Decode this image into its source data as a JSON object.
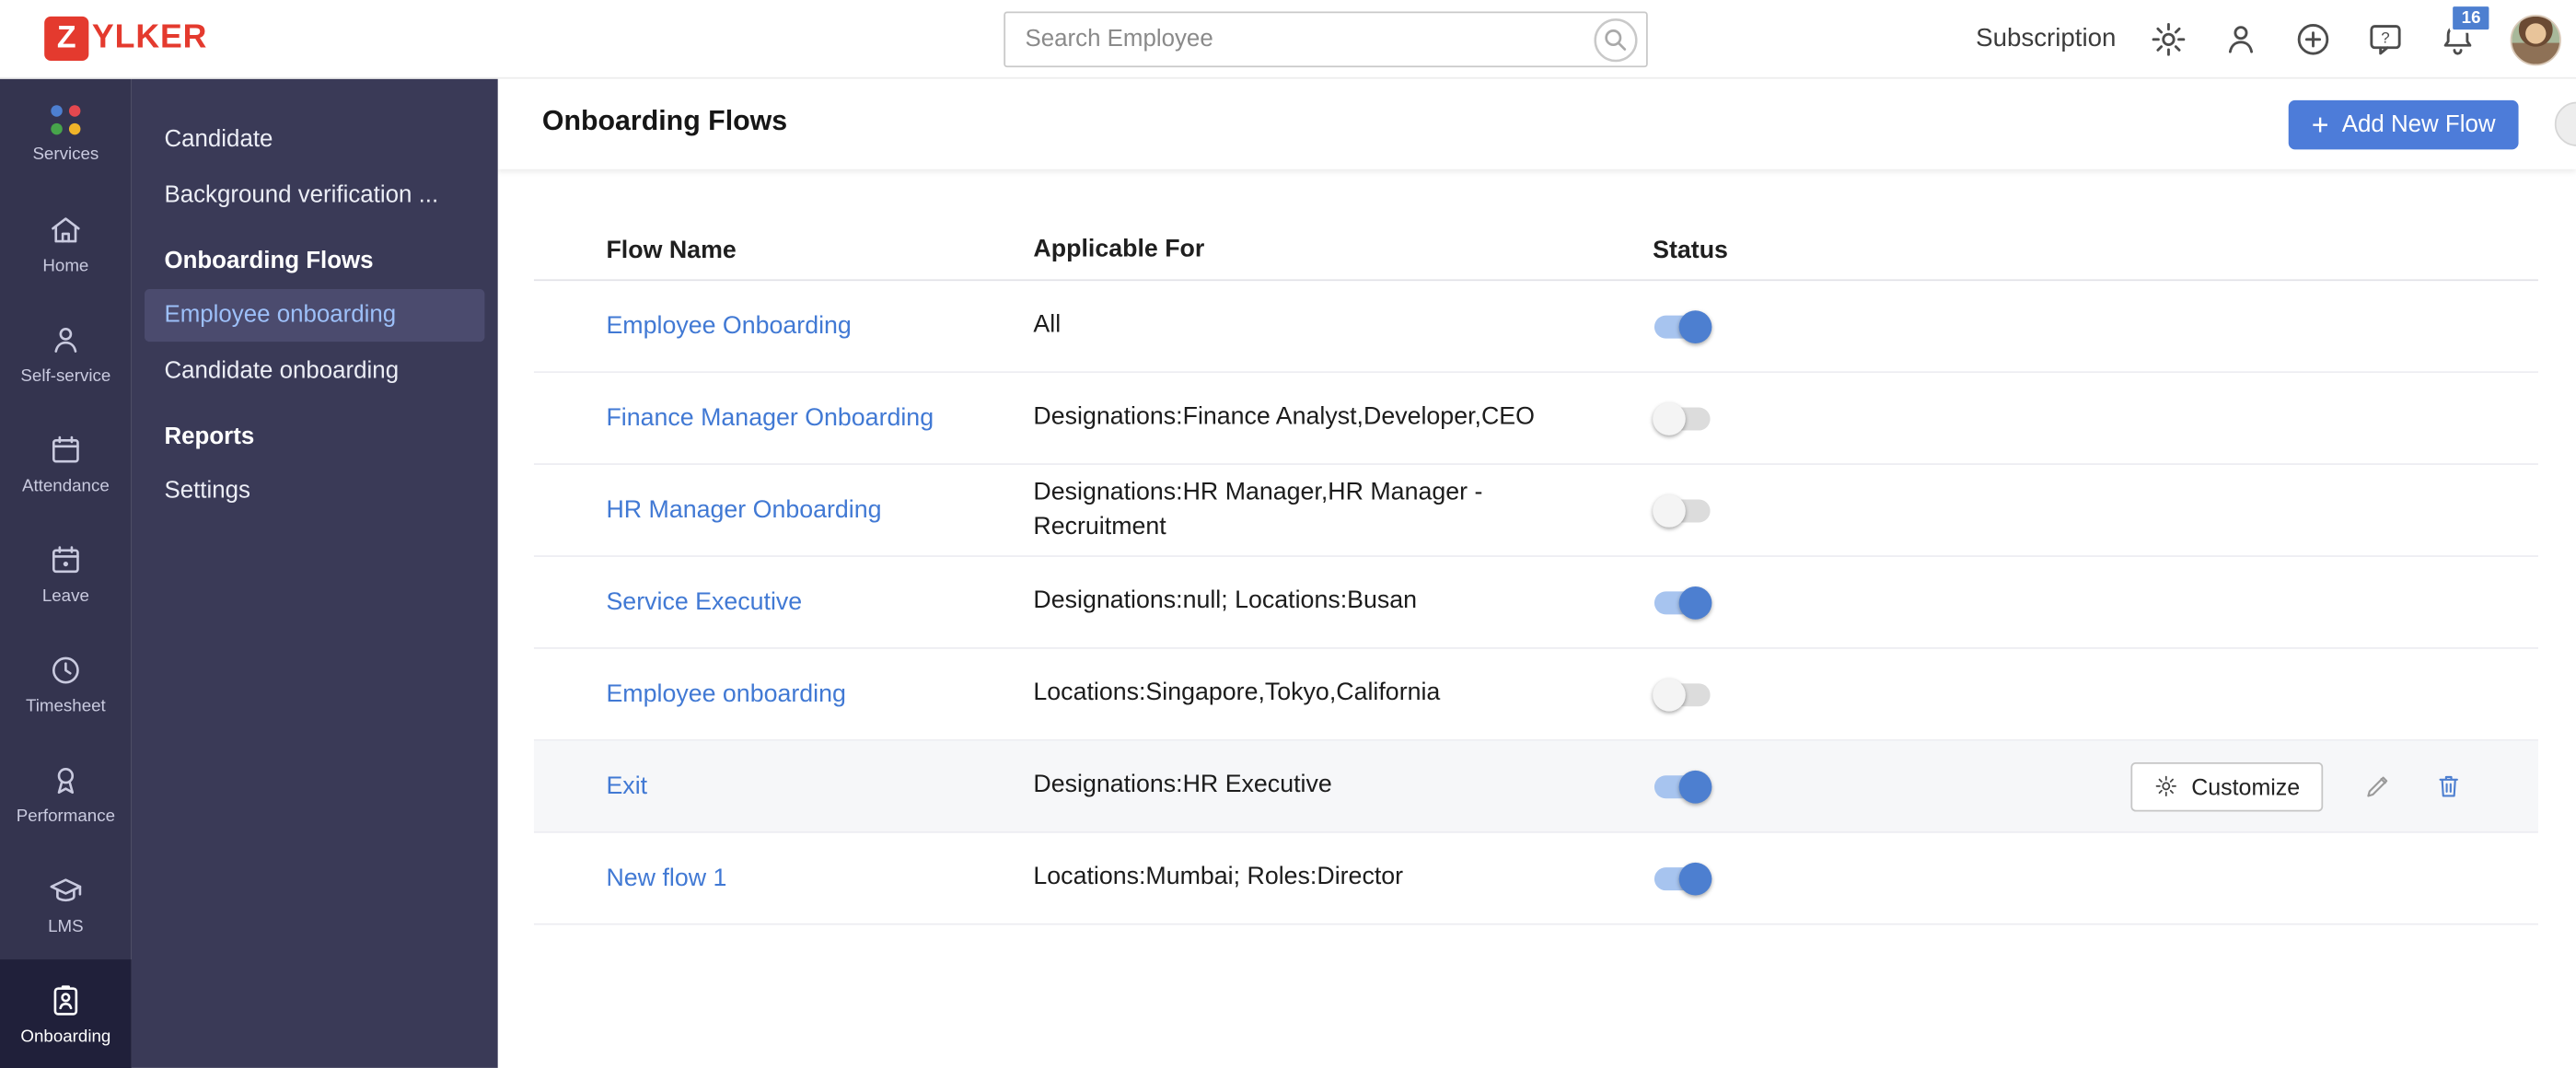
{
  "colors": {
    "logo_red": "#e43a2e",
    "accent_blue": "#4d7cd9",
    "link_blue": "#4179d4",
    "sidebar_bg": "#3a3a57",
    "rail_bg": "#34344f",
    "toggle_on": "#4d7fd0"
  },
  "header": {
    "logo": {
      "mark": "Z",
      "text": "YLKER"
    },
    "search": {
      "placeholder": "Search Employee"
    },
    "subscription_label": "Subscription",
    "bell_badge": "16"
  },
  "nav_rail": {
    "items": [
      {
        "label": "Services",
        "icon": "services-grid-icon"
      },
      {
        "label": "Home",
        "icon": "home-icon"
      },
      {
        "label": "Self-service",
        "icon": "person-icon"
      },
      {
        "label": "Attendance",
        "icon": "calendar-icon"
      },
      {
        "label": "Leave",
        "icon": "calendar-dot-icon"
      },
      {
        "label": "Timesheet",
        "icon": "clock-icon"
      },
      {
        "label": "Performance",
        "icon": "medal-icon"
      },
      {
        "label": "LMS",
        "icon": "graduation-cap-icon"
      },
      {
        "label": "Onboarding",
        "icon": "id-badge-icon",
        "active": true
      }
    ]
  },
  "sidebar": {
    "items": [
      {
        "label": "Candidate",
        "type": "item"
      },
      {
        "label": "Background verification ...",
        "type": "item"
      },
      {
        "label": "Onboarding Flows",
        "type": "section"
      },
      {
        "label": "Employee onboarding",
        "type": "item",
        "selected": true
      },
      {
        "label": "Candidate onboarding",
        "type": "item"
      },
      {
        "label": "Reports",
        "type": "section"
      },
      {
        "label": "Settings",
        "type": "item"
      }
    ]
  },
  "main": {
    "title": "Onboarding Flows",
    "add_button_label": "Add New Flow",
    "table": {
      "headers": [
        "Flow Name",
        "Applicable For",
        "Status"
      ],
      "customize_label": "Customize",
      "rows": [
        {
          "name": "Employee Onboarding",
          "applicable": "All",
          "status": true
        },
        {
          "name": "Finance Manager Onboarding",
          "applicable": "Designations:Finance Analyst,Developer,CEO",
          "status": false
        },
        {
          "name": "HR Manager Onboarding",
          "applicable": "Designations:HR Manager,HR Manager - Recruitment",
          "status": false
        },
        {
          "name": "Service Executive",
          "applicable": "Designations:null; Locations:Busan",
          "status": true
        },
        {
          "name": "Employee onboarding",
          "applicable": "Locations:Singapore,Tokyo,California",
          "status": false
        },
        {
          "name": "Exit",
          "applicable": "Designations:HR Executive",
          "status": true,
          "hovered": true
        },
        {
          "name": "New flow 1",
          "applicable": "Locations:Mumbai; Roles:Director",
          "status": true
        }
      ]
    }
  }
}
